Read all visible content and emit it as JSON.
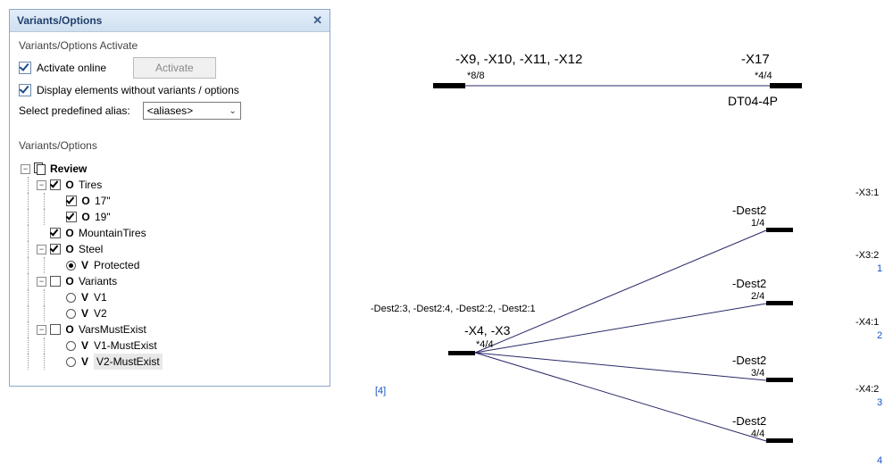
{
  "panel": {
    "title": "Variants/Options",
    "activate_section": "Variants/Options Activate",
    "activate_online": "Activate online",
    "activate_button": "Activate",
    "display_without": "Display elements without variants / options",
    "alias_label": "Select predefined alias:",
    "alias_value": "<aliases>",
    "tree_header": "Variants/Options"
  },
  "tree": {
    "root": "Review",
    "tires": {
      "label": "Tires",
      "c17": "17\"",
      "c19": "19\""
    },
    "mountain": "MountainTires",
    "steel": {
      "label": "Steel",
      "protected": "Protected"
    },
    "variants": {
      "label": "Variants",
      "v1": "V1",
      "v2": "V2"
    },
    "varsmust": {
      "label": "VarsMustExist",
      "v1m": "V1-MustExist",
      "v2m": "V2-MustExist"
    }
  },
  "schematic": {
    "top_left": "-X9, -X10, -X11, -X12",
    "top_left_sub": "*8/8",
    "top_right": "-X17",
    "top_right_sub": "*4/4",
    "dt": "DT04-4P",
    "left_bundle": "-Dest2:3, -Dest2:4, -Dest2:2, -Dest2:1",
    "left_center": "-X4, -X3",
    "left_center_sub": "*4/4",
    "marker": "[4]",
    "dest": "-Dest2",
    "d_sub": [
      "1/4",
      "2/4",
      "3/4",
      "4/4"
    ],
    "edge": [
      "-X3:1",
      "-X3:2",
      "-X4:1",
      "-X4:2"
    ],
    "edge_num": [
      "",
      "1",
      "2",
      "3",
      "4"
    ]
  }
}
